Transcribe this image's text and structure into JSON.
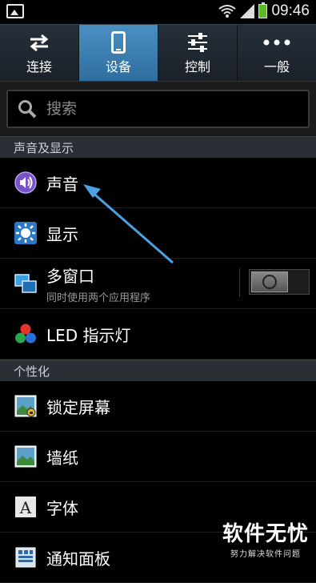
{
  "statusbar": {
    "time": "09:46"
  },
  "tabs": [
    {
      "label": "连接",
      "icon": "swap-arrows-icon",
      "active": false
    },
    {
      "label": "设备",
      "icon": "phone-device-icon",
      "active": true
    },
    {
      "label": "控制",
      "icon": "sliders-icon",
      "active": false
    },
    {
      "label": "一般",
      "icon": "more-dots-icon",
      "active": false
    }
  ],
  "search": {
    "placeholder": "搜索"
  },
  "sections": {
    "sound_display": "声音及显示",
    "personalization": "个性化"
  },
  "items": {
    "sound": {
      "label": "声音",
      "icon": "speaker-icon"
    },
    "display": {
      "label": "显示",
      "icon": "brightness-icon"
    },
    "multi_window": {
      "label": "多窗口",
      "sublabel": "同时使用两个应用程序",
      "icon": "multi-window-icon",
      "toggle": "off"
    },
    "led": {
      "label": "LED 指示灯",
      "icon": "led-dots-icon"
    },
    "lock_screen": {
      "label": "锁定屏幕",
      "icon": "lock-screen-icon"
    },
    "wallpaper": {
      "label": "墙纸",
      "icon": "wallpaper-icon"
    },
    "font": {
      "label": "字体",
      "icon": "font-icon"
    },
    "notification_panel": {
      "label": "通知面板",
      "icon": "notification-panel-icon"
    }
  },
  "watermark": {
    "main": "软件无忧",
    "sub": "努力解决软件问题"
  },
  "colors": {
    "active_tab": "#3f83b8",
    "section_bg": "#2a2f36",
    "arrow": "#4aa3e0",
    "sound_icon": "#7a52c7"
  }
}
